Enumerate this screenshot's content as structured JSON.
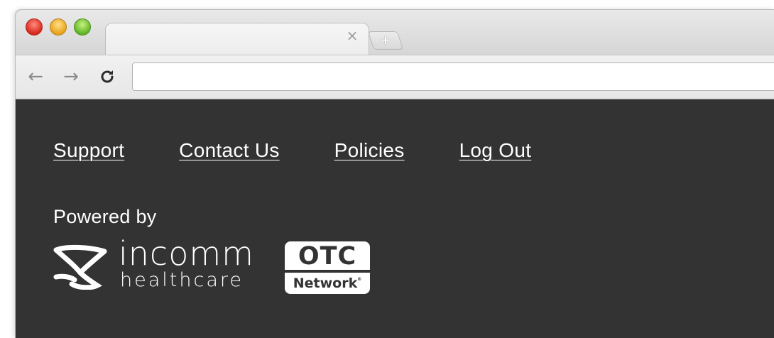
{
  "browser": {
    "tab_close_icon": "×",
    "new_tab_icon": "+",
    "back_icon": "←",
    "forward_icon": "→",
    "reload_icon": "C",
    "address_value": "",
    "address_placeholder": ""
  },
  "footer": {
    "links": [
      {
        "label": "Support"
      },
      {
        "label": "Contact Us"
      },
      {
        "label": "Policies"
      },
      {
        "label": "Log Out"
      }
    ],
    "powered_by": "Powered by",
    "incomm": {
      "wordmark": "incomm",
      "sub": "healthcare"
    },
    "otc": {
      "top": "OTC",
      "bottom": "Network",
      "mark": "®"
    }
  },
  "colors": {
    "page_bg": "#333333",
    "text": "#ffffff",
    "chrome": "#e6e6e6"
  }
}
